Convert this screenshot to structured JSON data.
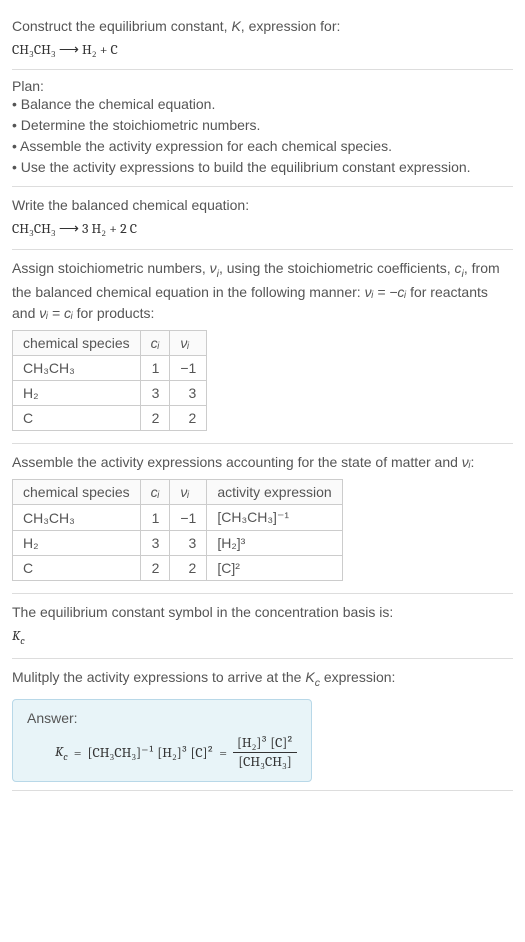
{
  "intro": {
    "line1": "Construct the equilibrium constant, ",
    "k": "K",
    "line1b": ", expression for:",
    "eq": "CH₃CH₃ ⟶ H₂ + C"
  },
  "plan": {
    "title": "Plan:",
    "items": [
      "• Balance the chemical equation.",
      "• Determine the stoichiometric numbers.",
      "• Assemble the activity expression for each chemical species.",
      "• Use the activity expressions to build the equilibrium constant expression."
    ]
  },
  "balanced": {
    "heading": "Write the balanced chemical equation:",
    "eq": "CH₃CH₃ ⟶ 3 H₂ + 2 C"
  },
  "stoich": {
    "text1": "Assign stoichiometric numbers, ",
    "nu": "ν",
    "sub_i": "i",
    "text2": ", using the stoichiometric coefficients, ",
    "c": "c",
    "text3": ", from the balanced chemical equation in the following manner: ",
    "rel1": "νᵢ = −cᵢ",
    "text4": " for reactants and ",
    "rel2": "νᵢ = cᵢ",
    "text5": " for products:",
    "table": {
      "h1": "chemical species",
      "h2": "cᵢ",
      "h3": "νᵢ",
      "rows": [
        {
          "sp": "CH₃CH₃",
          "c": "1",
          "v": "−1"
        },
        {
          "sp": "H₂",
          "c": "3",
          "v": "3"
        },
        {
          "sp": "C",
          "c": "2",
          "v": "2"
        }
      ]
    }
  },
  "activity": {
    "heading1": "Assemble the activity expressions accounting for the state of matter and ",
    "nu": "νᵢ",
    "heading2": ":",
    "table": {
      "h1": "chemical species",
      "h2": "cᵢ",
      "h3": "νᵢ",
      "h4": "activity expression",
      "rows": [
        {
          "sp": "CH₃CH₃",
          "c": "1",
          "v": "−1",
          "a": "[CH₃CH₃]⁻¹"
        },
        {
          "sp": "H₂",
          "c": "3",
          "v": "3",
          "a": "[H₂]³"
        },
        {
          "sp": "C",
          "c": "2",
          "v": "2",
          "a": "[C]²"
        }
      ]
    }
  },
  "symbol": {
    "heading": "The equilibrium constant symbol in the concentration basis is:",
    "kc": "K",
    "kc_sub": "c"
  },
  "final": {
    "heading1": "Mulitply the activity expressions to arrive at the ",
    "kc": "K",
    "kc_sub": "c",
    "heading2": " expression:",
    "answer_label": "Answer:",
    "lhs_k": "K",
    "lhs_sub": "c",
    "eq_sign": " = ",
    "term1": "[CH₃CH₃]⁻¹ [H₂]³ [C]²",
    "eq_sign2": " = ",
    "frac_top": "[H₂]³ [C]²",
    "frac_bot": "[CH₃CH₃]"
  }
}
